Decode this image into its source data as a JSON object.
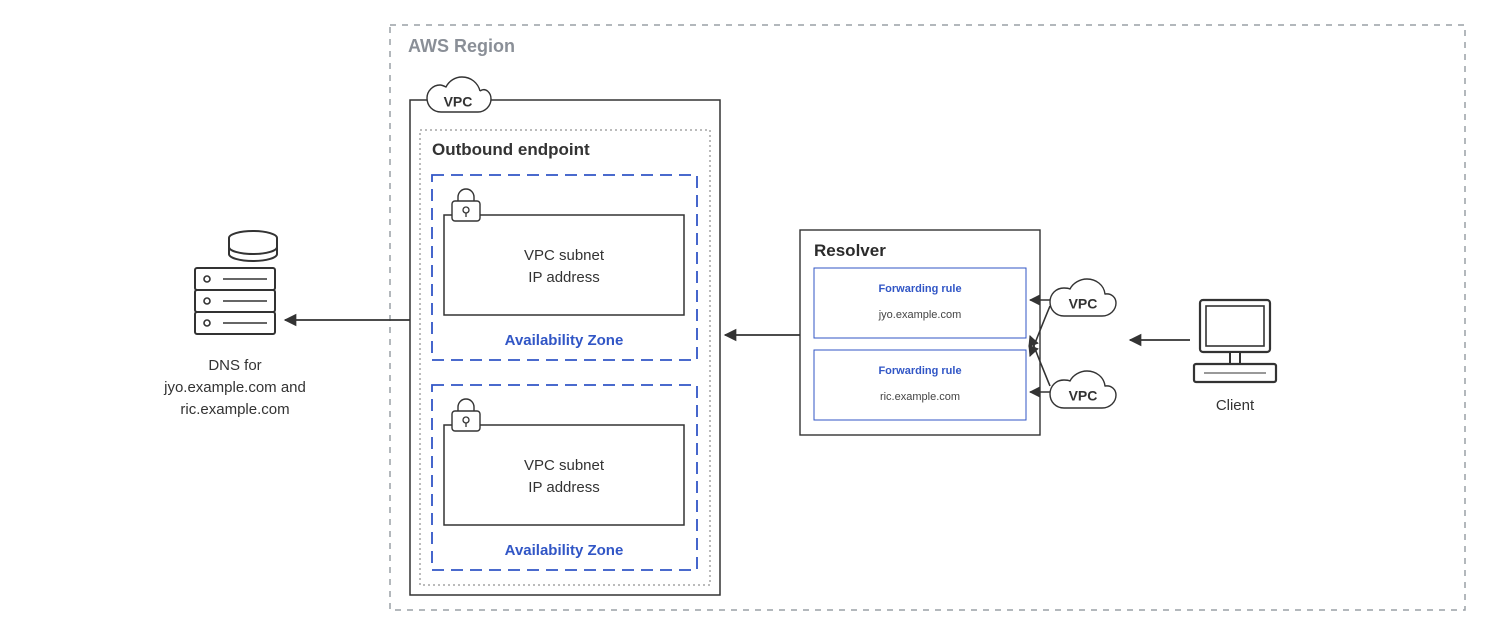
{
  "region_label": "AWS Region",
  "vpc_cloud_label": "VPC",
  "outbound_endpoint_label": "Outbound endpoint",
  "subnet_line1": "VPC subnet",
  "subnet_line2": "IP address",
  "az_label": "Availability Zone",
  "resolver_label": "Resolver",
  "rules": [
    {
      "title": "Forwarding rule",
      "domain": "jyo.example.com"
    },
    {
      "title": "Forwarding rule",
      "domain": "ric.example.com"
    }
  ],
  "resolver_vpc_label": "VPC",
  "client_label": "Client",
  "dns_caption_line1": "DNS for",
  "dns_caption_line2": "jyo.example.com and",
  "dns_caption_line3": "ric.example.com"
}
